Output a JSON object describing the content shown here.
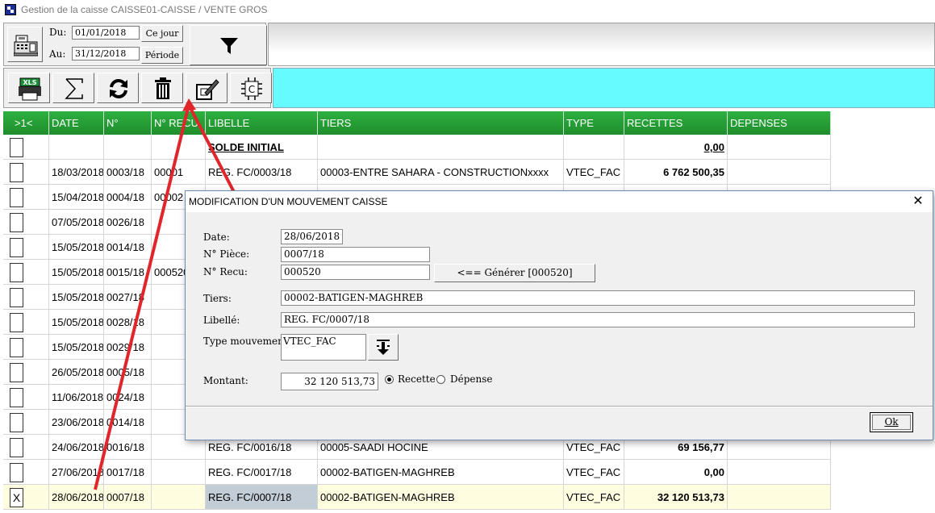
{
  "window": {
    "title": "Gestion de la caisse CAISSE01-CAISSE / VENTE GROS"
  },
  "filters": {
    "du_label": "Du:",
    "au_label": "Au:",
    "du_value": "01/01/2018",
    "au_value": "31/12/2018",
    "today_button": "Ce jour",
    "period_button": "Période"
  },
  "grid": {
    "headers": [
      ">1<",
      "DATE",
      "N° PIECE",
      "N° RECU",
      "LIBELLE",
      "TIERS",
      "TYPE",
      "RECETTES",
      "DEPENSES"
    ],
    "rows": [
      {
        "check": "",
        "date": "",
        "piece": "",
        "recu": "",
        "libelle": "SOLDE INITIAL",
        "tiers": "",
        "type": "",
        "recettes": "0,00",
        "depenses": ""
      },
      {
        "check": "",
        "date": "18/03/2018",
        "piece": "0003/18",
        "recu": "00001",
        "libelle": "REG. FC/0003/18",
        "tiers": "00003-ENTRE SAHARA - CONSTRUCTIONxxxx",
        "type": "VTEC_FAC",
        "recettes": "6 762 500,35",
        "depenses": ""
      },
      {
        "check": "",
        "date": "15/04/2018",
        "piece": "0004/18",
        "recu": "00002",
        "libelle": "",
        "tiers": "",
        "type": "",
        "recettes": "",
        "depenses": ""
      },
      {
        "check": "",
        "date": "07/05/2018",
        "piece": "0026/18",
        "recu": "",
        "libelle": "",
        "tiers": "",
        "type": "",
        "recettes": "",
        "depenses": ""
      },
      {
        "check": "",
        "date": "15/05/2018",
        "piece": "0014/18",
        "recu": "",
        "libelle": "",
        "tiers": "",
        "type": "",
        "recettes": "",
        "depenses": ""
      },
      {
        "check": "",
        "date": "15/05/2018",
        "piece": "0015/18",
        "recu": "000520",
        "libelle": "",
        "tiers": "",
        "type": "",
        "recettes": "",
        "depenses": ""
      },
      {
        "check": "",
        "date": "15/05/2018",
        "piece": "0027/18",
        "recu": "",
        "libelle": "",
        "tiers": "",
        "type": "",
        "recettes": "",
        "depenses": ""
      },
      {
        "check": "",
        "date": "15/05/2018",
        "piece": "0028/18",
        "recu": "",
        "libelle": "",
        "tiers": "",
        "type": "",
        "recettes": "",
        "depenses": ""
      },
      {
        "check": "",
        "date": "15/05/2018",
        "piece": "0029/18",
        "recu": "",
        "libelle": "",
        "tiers": "",
        "type": "",
        "recettes": "",
        "depenses": ""
      },
      {
        "check": "",
        "date": "26/05/2018",
        "piece": "0005/18",
        "recu": "",
        "libelle": "",
        "tiers": "",
        "type": "",
        "recettes": "",
        "depenses": ""
      },
      {
        "check": "",
        "date": "11/06/2018",
        "piece": "0024/18",
        "recu": "",
        "libelle": "",
        "tiers": "",
        "type": "",
        "recettes": "",
        "depenses": ""
      },
      {
        "check": "",
        "date": "23/06/2018",
        "piece": "0014/18",
        "recu": "",
        "libelle": "",
        "tiers": "",
        "type": "",
        "recettes": "",
        "depenses": ""
      },
      {
        "check": "",
        "date": "24/06/2018",
        "piece": "0016/18",
        "recu": "",
        "libelle": "REG. FC/0016/18",
        "tiers": "00005-SAADI HOCINE",
        "type": "VTEC_FAC",
        "recettes": "69 156,77",
        "depenses": ""
      },
      {
        "check": "",
        "date": "27/06/2018",
        "piece": "0017/18",
        "recu": "",
        "libelle": "REG. FC/0017/18",
        "tiers": "00002-BATIGEN-MAGHREB",
        "type": "VTEC_FAC",
        "recettes": "0,00",
        "depenses": ""
      },
      {
        "check": "X",
        "date": "28/06/2018",
        "piece": "0007/18",
        "recu": "",
        "libelle": "REG. FC/0007/18",
        "tiers": "00002-BATIGEN-MAGHREB",
        "type": "VTEC_FAC",
        "recettes": "32 120 513,73",
        "depenses": ""
      }
    ]
  },
  "dialog": {
    "title": "MODIFICATION D'UN MOUVEMENT CAISSE",
    "close": "✕",
    "date_label": "Date:",
    "date_value": "28/06/2018",
    "piece_label": "N° Pièce:",
    "piece_value": "0007/18",
    "recu_label": "N° Recu:",
    "recu_value": "000520",
    "generate_button": "<== Générer [000520]",
    "tiers_label": "Tiers:",
    "tiers_value": "00002-BATIGEN-MAGHREB",
    "libelle_label": "Libellé:",
    "libelle_value": "REG. FC/0007/18",
    "type_label": "Type mouvement:",
    "type_value": "VTEC_FAC",
    "montant_label": "Montant:",
    "montant_value": "32 120 513,73",
    "recette_label": "Recette",
    "depense_label": "Dépense",
    "ok_button": "Ok"
  },
  "colors": {
    "header_green": "#1f8d2c",
    "cyan_bar": "#66fbff",
    "annotation_red": "#e0262b"
  }
}
